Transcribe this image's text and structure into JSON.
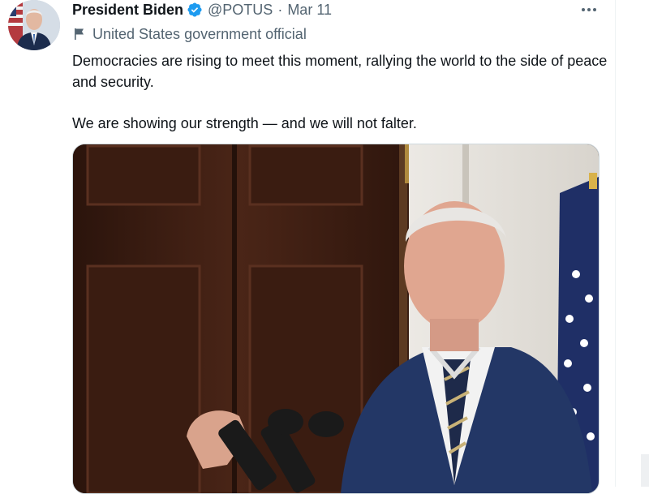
{
  "tweet": {
    "author": {
      "name": "President Biden",
      "handle": "@POTUS",
      "separator": "·",
      "date": "Mar 11",
      "verified_icon": "verified-badge-icon",
      "avatar_icon": "profile-avatar"
    },
    "label": {
      "icon": "flag-icon",
      "text": "United States government official"
    },
    "more_icon": "more-options-icon",
    "text": {
      "paragraph_1": "Democracies are rising to meet this moment, rallying the world to the side of peace and security.",
      "paragraph_2": "We are showing our strength — and we will not falter."
    },
    "media": {
      "type": "video-still",
      "subject": "speaker-at-podium-image"
    }
  },
  "colors": {
    "text_primary": "#0f1419",
    "text_secondary": "#536471",
    "verified_blue": "#1d9bf0",
    "border": "#cfd9de"
  }
}
